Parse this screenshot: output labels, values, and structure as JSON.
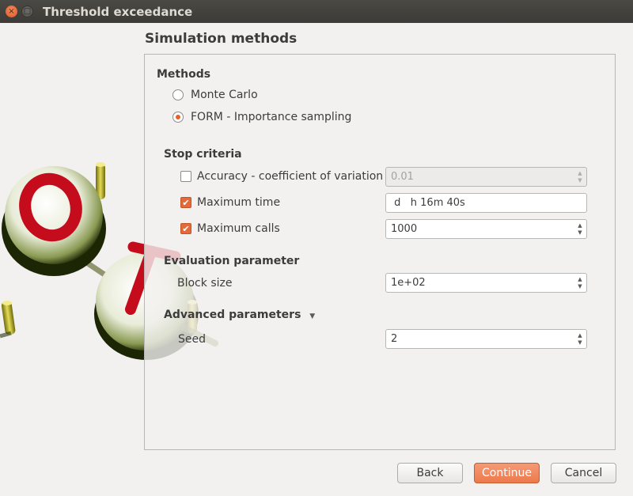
{
  "window": {
    "title": "Threshold exceedance",
    "close_glyph": "×",
    "maximize_glyph": "□"
  },
  "page_title": "Simulation methods",
  "methods": {
    "heading": "Methods",
    "options": [
      {
        "label": "Monte Carlo",
        "selected": false
      },
      {
        "label": "FORM - Importance sampling",
        "selected": true
      }
    ]
  },
  "stop_criteria": {
    "heading": "Stop criteria",
    "accuracy": {
      "label": "Accuracy - coefficient of variation",
      "checked": false,
      "value": "0.01"
    },
    "max_time": {
      "label": "Maximum time",
      "checked": true,
      "value": " d   h 16m 40s"
    },
    "max_calls": {
      "label": "Maximum calls",
      "checked": true,
      "value": "1000"
    }
  },
  "evaluation": {
    "heading": "Evaluation parameter",
    "block_size": {
      "label": "Block size",
      "value": "1e+02"
    }
  },
  "advanced": {
    "heading": "Advanced parameters",
    "expand_icon": "caret-down-icon",
    "seed": {
      "label": "Seed",
      "value": "2"
    }
  },
  "buttons": {
    "back": "Back",
    "continue": "Continue",
    "cancel": "Cancel"
  },
  "colors": {
    "accent": "#e4612b",
    "titlebar": "#3c3b37",
    "logo_red": "#d01020"
  }
}
